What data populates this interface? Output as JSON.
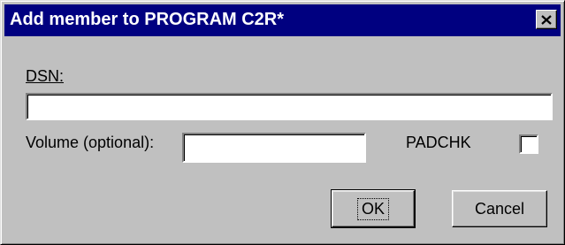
{
  "window": {
    "title": "Add member to PROGRAM C2R*",
    "close_icon": "close-icon"
  },
  "form": {
    "dsn_label": "DSN:",
    "dsn_value": "",
    "volume_label": "Volume (optional):",
    "volume_value": "",
    "padchk_label": "PADCHK",
    "padchk_checked": false
  },
  "buttons": {
    "ok_label": "OK",
    "cancel_label": "Cancel"
  },
  "colors": {
    "titlebar": "#000080",
    "face": "#c0c0c0"
  }
}
